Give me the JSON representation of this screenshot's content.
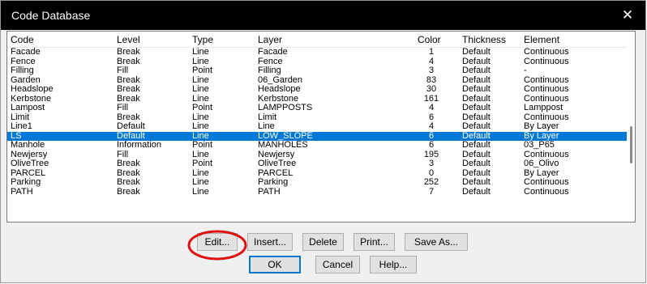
{
  "window": {
    "title": "Code Database",
    "close_glyph": "✕"
  },
  "columns": [
    "Code",
    "Level",
    "Type",
    "Layer",
    "Color",
    "Thickness",
    "Element"
  ],
  "rows": [
    [
      "Facade",
      "Break",
      "Line",
      "Facade",
      "1",
      "Default",
      "Continuous"
    ],
    [
      "Fence",
      "Break",
      "Line",
      "Fence",
      "4",
      "Default",
      "Continuous"
    ],
    [
      "Filling",
      "Fill",
      "Point",
      "Filling",
      "3",
      "Default",
      "-"
    ],
    [
      "Garden",
      "Break",
      "Line",
      "06_Garden",
      "83",
      "Default",
      "Continuous"
    ],
    [
      "Headslope",
      "Break",
      "Line",
      "Headslope",
      "30",
      "Default",
      "Continuous"
    ],
    [
      "Kerbstone",
      "Break",
      "Line",
      "Kerbstone",
      "161",
      "Default",
      "Continuous"
    ],
    [
      "Lampost",
      "Fill",
      "Point",
      "LAMPPOSTS",
      "4",
      "Default",
      "Lamppost"
    ],
    [
      "Limit",
      "Break",
      "Line",
      "Limit",
      "6",
      "Default",
      "Continuous"
    ],
    [
      "Line1",
      "Default",
      "Line",
      "Line",
      "4",
      "Default",
      "By Layer"
    ],
    [
      "LS",
      "Default",
      "Line",
      "LOW_SLOPE",
      "6",
      "Default",
      "By Layer"
    ],
    [
      "Manhole",
      "Information",
      "Point",
      "MANHOLES",
      "6",
      "Default",
      "03_P65"
    ],
    [
      "Newjersy",
      "Fill",
      "Line",
      "Newjersy",
      "195",
      "Default",
      "Continuous"
    ],
    [
      "OliveTree",
      "Break",
      "Point",
      "OliveTree",
      "3",
      "Default",
      "06_Olivo"
    ],
    [
      "PARCEL",
      "Break",
      "Line",
      "PARCEL",
      "0",
      "Default",
      "By Layer"
    ],
    [
      "Parking",
      "Break",
      "Line",
      "Parking",
      "252",
      "Default",
      "Continuous"
    ],
    [
      "PATH",
      "Break",
      "Line",
      "PATH",
      "7",
      "Default",
      "Continuous"
    ]
  ],
  "selected_row_index": 9,
  "buttons": {
    "edit": "Edit...",
    "insert": "Insert...",
    "delete": "Delete",
    "print": "Print...",
    "save_as": "Save As...",
    "ok": "OK",
    "cancel": "Cancel",
    "help": "Help..."
  },
  "colors": {
    "selection": "#0078d7",
    "annotation_circle": "#e01010",
    "titlebar": "#000000"
  }
}
